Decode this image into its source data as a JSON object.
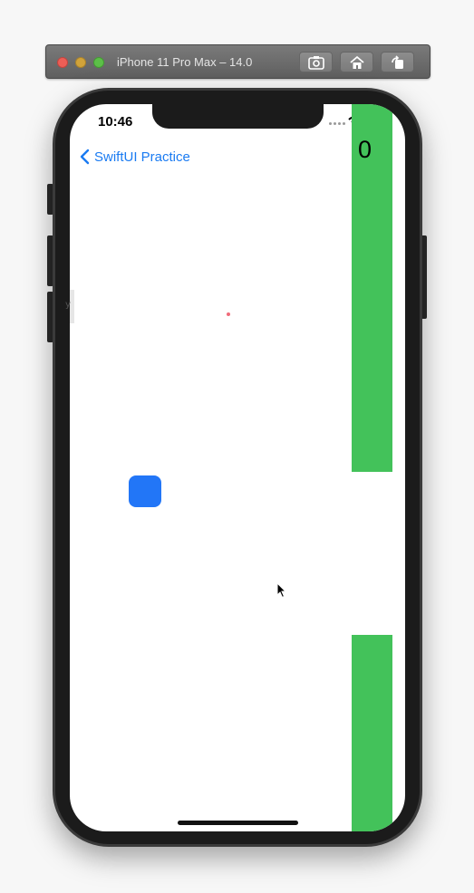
{
  "simulator": {
    "title": "iPhone 11 Pro Max – 14.0",
    "buttons": [
      "screenshot",
      "home",
      "rotate"
    ]
  },
  "status_bar": {
    "time": "10:46"
  },
  "nav": {
    "back_label": "SwiftUI Practice",
    "back_icon": "chevron-left-icon"
  },
  "game": {
    "score": "0",
    "colors": {
      "pipe": "#43c25a",
      "player": "#2276f7",
      "accent": "#1a7bf2",
      "dot": "#f06b79"
    }
  },
  "side_tab_glyph": "y"
}
